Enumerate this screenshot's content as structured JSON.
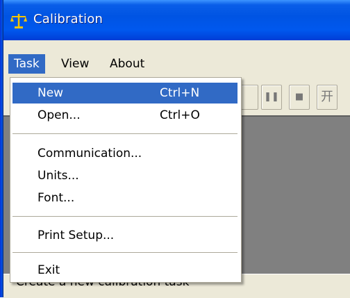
{
  "window": {
    "title": "Calibration",
    "icon": "balance-scale-icon"
  },
  "menubar": {
    "items": [
      "Task",
      "View",
      "About"
    ],
    "active": "Task"
  },
  "task_menu": {
    "items": [
      {
        "label": "New",
        "shortcut": "Ctrl+N",
        "highlighted": true
      },
      {
        "label": "Open...",
        "shortcut": "Ctrl+O"
      },
      {
        "label": "Communication..."
      },
      {
        "label": "Units..."
      },
      {
        "label": "Font..."
      },
      {
        "label": "Print Setup..."
      },
      {
        "label": "Exit"
      }
    ]
  },
  "toolbar": {
    "visible_buttons": [
      "pause-icon",
      "stop-icon",
      "text-icon"
    ]
  },
  "statusbar": {
    "text": "Create a new calibration task"
  },
  "colors": {
    "titlebar": "#0054e3",
    "highlight": "#316ac5",
    "workspace": "#808080"
  }
}
